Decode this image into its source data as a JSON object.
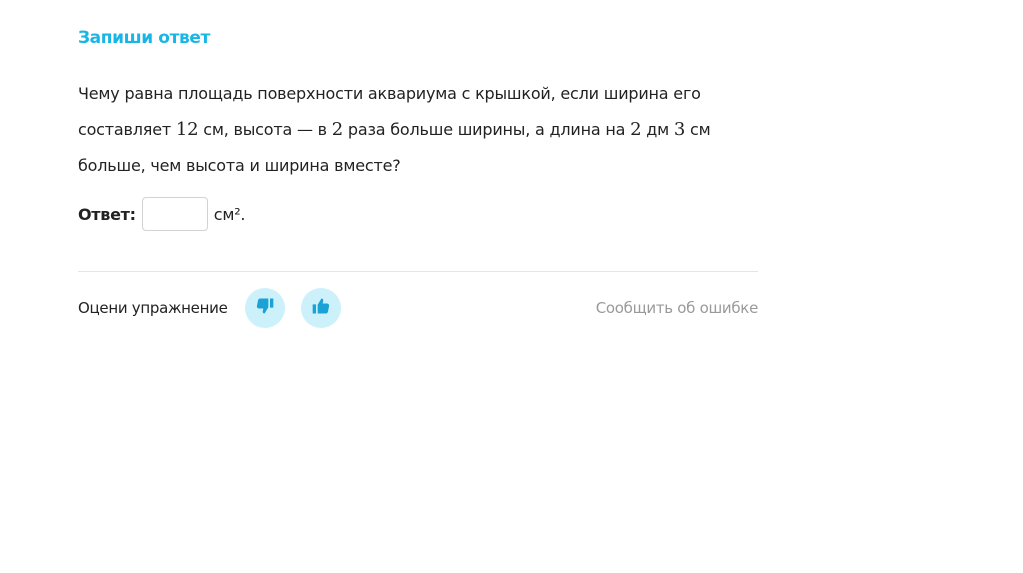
{
  "task": {
    "title": "Запиши ответ",
    "question": {
      "line1": {
        "text": "Чему равна площадь поверхности аквариума с крышкой, если ширина его"
      },
      "line2": {
        "t1": "составляет ",
        "n1": "12",
        "t2": " см, высота — в ",
        "n2": "2",
        "t3": " раза больше ширины, а длина на ",
        "n3": "2",
        "t4": " дм ",
        "n4": "3",
        "t5": " см"
      },
      "line3": {
        "text": "больше, чем высота и ширина вместе?"
      }
    },
    "answer": {
      "label": "Ответ:",
      "value": "",
      "placeholder": "",
      "unit": "см²."
    }
  },
  "footer": {
    "rate_label": "Оцени упражнение",
    "report_label": "Сообщить об ошибке"
  },
  "icons": {
    "dislike": "thumbs-down-icon",
    "like": "thumbs-up-icon"
  },
  "colors": {
    "accent": "#18b6e6",
    "button_bg": "#ccf1fb",
    "icon": "#1aa2d6",
    "text": "#222222",
    "muted": "#9a9a9a",
    "divider": "#e6e6e6"
  }
}
